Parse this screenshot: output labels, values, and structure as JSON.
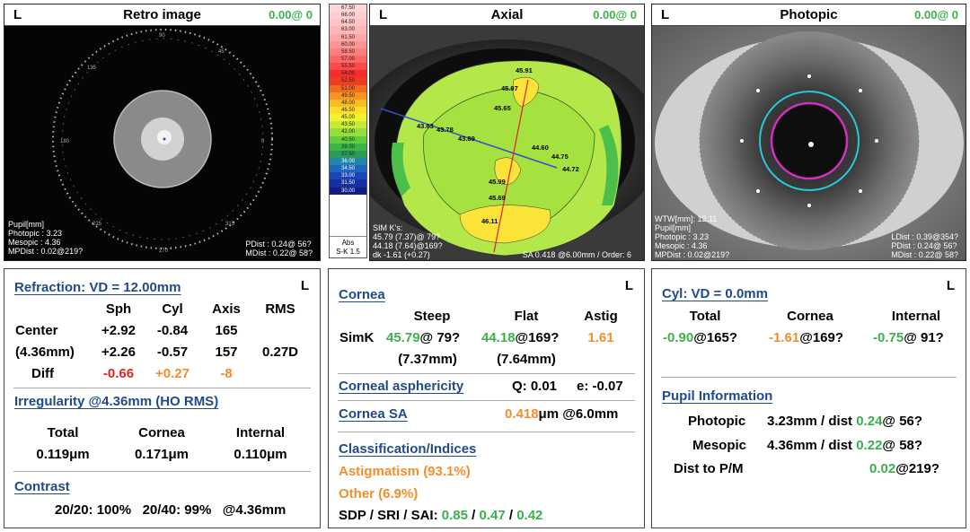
{
  "retro": {
    "eye": "L",
    "title": "Retro image",
    "value": "0.00@ 0",
    "overlay": {
      "pupil_label": "Pupil[mm]",
      "photopic": "Photopic : 3.23",
      "mesopic": "Mesopic : 4.36",
      "mpdist": "MPDist : 0.02@219?",
      "pdist": "PDist : 0.24@ 56?",
      "mdist": "MDist : 0.22@ 58?"
    }
  },
  "axial": {
    "eye": "L",
    "title": "Axial",
    "value": "0.00@ 0",
    "scale": [
      "67.50",
      "66.00",
      "64.50",
      "63.00",
      "61.50",
      "60.00",
      "58.50",
      "57.00",
      "55.50",
      "54.00",
      "52.50",
      "51.00",
      "49.50",
      "48.00",
      "46.50",
      "45.00",
      "43.50",
      "42.00",
      "40.50",
      "39.00",
      "37.50",
      "36.00",
      "34.50",
      "33.00",
      "31.50",
      "30.00"
    ],
    "scale_colors": [
      "#ffd7d7",
      "#ffcfcf",
      "#ffc4c4",
      "#ffb6b6",
      "#ffa6a6",
      "#ff9494",
      "#ff7f7f",
      "#ff6666",
      "#ff4848",
      "#f52d2d",
      "#f03c22",
      "#f26a1d",
      "#f79520",
      "#fbbb22",
      "#fddf29",
      "#f2f22c",
      "#c5ec33",
      "#94df3a",
      "#5fce3e",
      "#3ab646",
      "#2a9c58",
      "#2287a6",
      "#1d67c3",
      "#1947b8",
      "#1530a2",
      "#101c84"
    ],
    "scale_footer": [
      "Abs",
      "S-K 1.5"
    ],
    "map_values": [
      "45.91",
      "45.97",
      "45.65",
      "43.63",
      "43.78",
      "43.89",
      "44.60",
      "44.75",
      "44.72",
      "45.99",
      "45.69",
      "46.11"
    ],
    "overlay": {
      "simk_label": "SIM K's:",
      "simk_steep": "45.79 (7.37)@ 79?",
      "simk_flat": "44.18 (7.64)@169?",
      "dk": "dk -1.61 (+0.27)",
      "sa": "SA  0.418 @6.00mm / Order: 6"
    }
  },
  "photopic": {
    "eye": "L",
    "title": "Photopic",
    "value": "0.00@ 0",
    "overlay": {
      "wtw": "WTW[mm]: 12.11",
      "pupil_label": "Pupil[mm]",
      "photopic": "Photopic : 3.23",
      "mesopic": "Mesopic : 4.36",
      "mpdist": "MPDist : 0.02@219?",
      "ldist": "LDist : 0.39@354?",
      "pdist": "PDist : 0.24@ 56?",
      "mdist": "MDist : 0.22@ 58?"
    }
  },
  "refraction": {
    "eye": "L",
    "header": "Refraction: VD = 12.00mm",
    "columns": [
      "Sph",
      "Cyl",
      "Axis",
      "RMS"
    ],
    "row1_label": "Center",
    "row1": [
      "+2.92",
      "-0.84",
      "165",
      ""
    ],
    "row2_label": "(4.36mm)",
    "row2": [
      "+2.26",
      "-0.57",
      "157",
      "0.27D"
    ],
    "row3_label": "Diff",
    "row3": [
      "-0.66",
      "+0.27",
      "-8",
      ""
    ],
    "irregularity_header": "Irregularity @4.36mm (HO RMS)",
    "irr_columns": [
      "Total",
      "Cornea",
      "Internal"
    ],
    "irr_values": [
      "0.119μm",
      "0.171μm",
      "0.110μm"
    ],
    "contrast_header": "Contrast",
    "contrast_line": "20/20: 100%   20/40: 99%   @4.36mm"
  },
  "cornea": {
    "eye": "L",
    "header": "Cornea",
    "columns": [
      "Steep",
      "Flat",
      "Astig"
    ],
    "simk_label": "SimK",
    "steep_val": "45.79",
    "steep_axis": "@ 79?",
    "flat_val": "44.18",
    "flat_axis": "@169?",
    "astig": "1.61",
    "steep_mm": "(7.37mm)",
    "flat_mm": "(7.64mm)",
    "asphericity_header": "Corneal asphericity",
    "q": "Q: 0.01",
    "e": "e: -0.07",
    "sa_header": "Cornea SA",
    "sa_value": "0.418",
    "sa_suffix": "μm @6.0mm",
    "class_header": "Classification/Indices",
    "astigmatism": "Astigmatism (93.1%)",
    "other": "Other (6.9%)",
    "indices_label": "SDP / SRI / SAI:",
    "sdp": "0.85",
    "sri": "0.47",
    "sai": "0.42",
    "sep": "/"
  },
  "cyl": {
    "eye": "L",
    "header": "Cyl: VD = 0.0mm",
    "columns": [
      "Total",
      "Cornea",
      "Internal"
    ],
    "total_val": "-0.90",
    "total_axis": "@165?",
    "cornea_val": "-1.61",
    "cornea_axis": "@169?",
    "internal_val": "-0.75",
    "internal_axis": "@ 91?",
    "pupil_header": "Pupil Information",
    "photopic_label": "Photopic",
    "photopic_mm": "3.23mm / dist",
    "photopic_dist": "0.24",
    "photopic_axis": "@ 56?",
    "mesopic_label": "Mesopic",
    "mesopic_mm": "4.36mm / dist",
    "mesopic_dist": "0.22",
    "mesopic_axis": "@ 58?",
    "dist_label": "Dist to P/M",
    "dist_val": "0.02",
    "dist_axis": "@219?"
  },
  "colors": {
    "header_blue": "#1f4a8c",
    "green": "#3cb04b",
    "orange": "#f28e2b",
    "red": "#e02424"
  }
}
